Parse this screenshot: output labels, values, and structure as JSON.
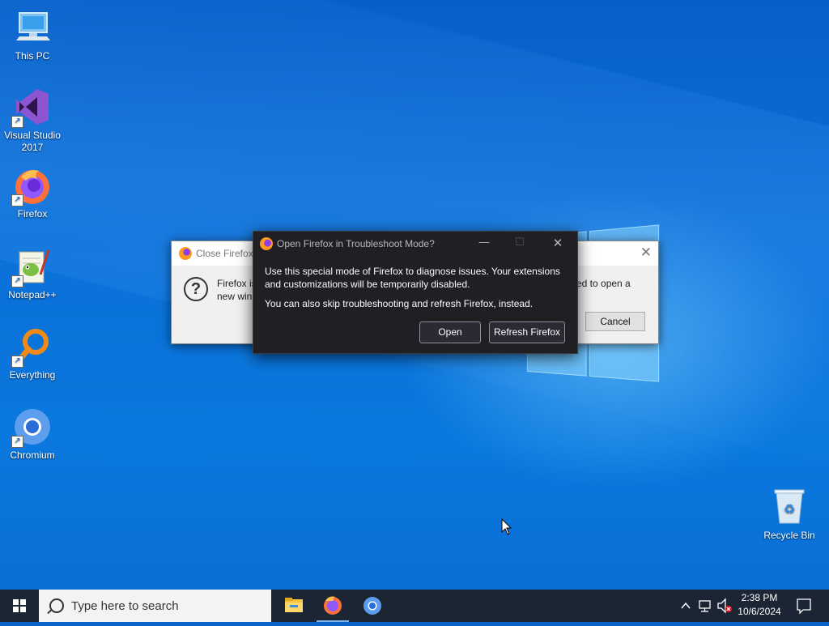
{
  "desktop": {
    "icons": [
      {
        "label": "This PC",
        "icon": "computer-icon"
      },
      {
        "label": "Visual Studio 2017",
        "icon": "visual-studio-icon"
      },
      {
        "label": "Firefox",
        "icon": "firefox-icon"
      },
      {
        "label": "Notepad++",
        "icon": "notepadpp-icon"
      },
      {
        "label": "Everything",
        "icon": "everything-icon"
      },
      {
        "label": "Chromium",
        "icon": "chromium-icon"
      },
      {
        "label": "Recycle Bin",
        "icon": "recycle-bin-icon"
      }
    ]
  },
  "close_dialog": {
    "title": "Close Firefox",
    "message_left_1": "Firefox is",
    "message_left_2": "new win",
    "message_right": "sed to open a",
    "cancel_label": "Cancel"
  },
  "troubleshoot_dialog": {
    "title": "Open Firefox in Troubleshoot Mode?",
    "paragraph1": "Use this special mode of Firefox to diagnose issues. Your extensions and customizations will be temporarily disabled.",
    "paragraph2": "You can also skip troubleshooting and refresh Firefox, instead.",
    "open_label": "Open",
    "refresh_label": "Refresh Firefox"
  },
  "taskbar": {
    "search_placeholder": "Type here to search",
    "pinned": [
      "file-explorer-icon",
      "firefox-icon",
      "chromium-icon"
    ],
    "time": "2:38 PM",
    "date": "10/6/2024"
  },
  "colors": {
    "accent": "#0a64c8",
    "dark_dialog": "#202024",
    "taskbar": "#1b2533"
  }
}
